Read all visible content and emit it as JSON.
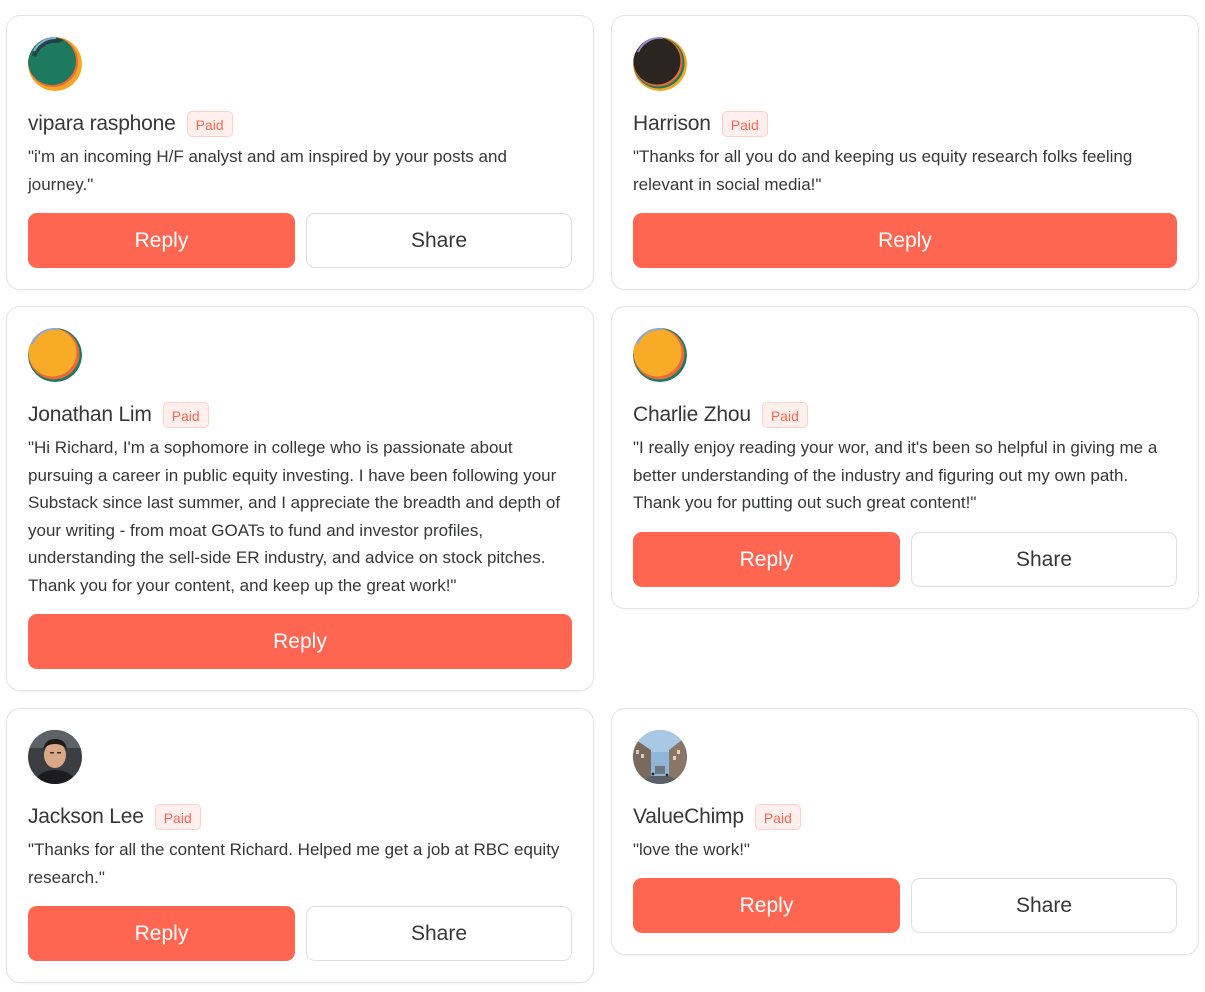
{
  "theme": {
    "accent": "#ff6651",
    "badge_bg": "#fff0ee",
    "text": "#363737"
  },
  "cards": [
    {
      "name": "vipara rasphone",
      "badge": "Paid",
      "avatar": "abstract-green-orange-avatar",
      "quote": "\"i'm an incoming H/F analyst and am inspired by your posts and journey.\"",
      "reply_label": "Reply",
      "share_label": "Share"
    },
    {
      "name": "Harrison",
      "badge": "Paid",
      "avatar": "abstract-dark-avatar",
      "quote": "\"Thanks for all you do and keeping us equity research folks feeling relevant in social media!\"",
      "reply_label": "Reply"
    },
    {
      "name": "Jonathan Lim",
      "badge": "Paid",
      "avatar": "abstract-yellow-green-avatar",
      "quote": "\"Hi Richard, I'm a sophomore in college who is passionate about pursuing a career in public equity investing. I have been following your Substack since last summer, and I appreciate the breadth and depth of your writing - from moat GOATs to fund and investor profiles, understanding the sell-side ER industry, and advice on stock pitches. Thank you for your content, and keep up the great work!\"",
      "reply_label": "Reply"
    },
    {
      "name": "Charlie Zhou",
      "badge": "Paid",
      "avatar": "abstract-yellow-green-avatar",
      "quote": "\"I really enjoy reading your wor, and it's been so helpful in giving me a better understanding of the industry and figuring out my own path. Thank you for putting out such great content!\"",
      "reply_label": "Reply",
      "share_label": "Share"
    },
    {
      "name": "Jackson Lee",
      "badge": "Paid",
      "avatar": "person-photo-avatar",
      "quote": "\"Thanks for all the content Richard. Helped me get a job at RBC equity research.\"",
      "reply_label": "Reply",
      "share_label": "Share"
    },
    {
      "name": "ValueChimp",
      "badge": "Paid",
      "avatar": "street-photo-avatar",
      "quote": "\"love the work!\"",
      "reply_label": "Reply",
      "share_label": "Share"
    }
  ]
}
